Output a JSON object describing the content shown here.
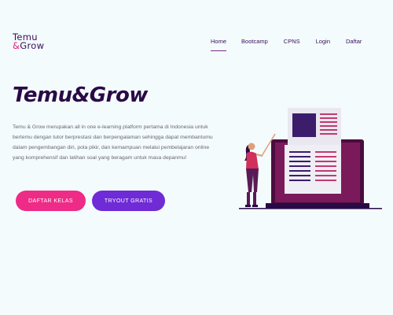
{
  "logo": {
    "line1": "Temu",
    "amp": "&",
    "line2_rest": "Grow"
  },
  "nav": {
    "items": [
      {
        "label": "Home",
        "active": true
      },
      {
        "label": "Bootcamp",
        "active": false
      },
      {
        "label": "CPNS",
        "active": false
      },
      {
        "label": "Login",
        "active": false
      },
      {
        "label": "Daftar",
        "active": false
      }
    ]
  },
  "hero": {
    "title": "Temu&Grow",
    "description": "Temu & Grow merupakan all in one e-learning platform pertama di Indonesia untuk bertemu dengan tutor berprestasi dan berpengalaman sehingga dapat membantumu dalam pengembangan diri, pola pikir, dan kemampuan melalui pembelajaran online yang komprehensif dan latihan soal yang beragam untuk masa depanmu!",
    "primary_button": "DAFTAR KELAS",
    "secondary_button": "TRYOUT GRATIS"
  },
  "colors": {
    "background": "#f3fbfd",
    "brand_dark": "#2a0a45",
    "accent_pink": "#ee2b87",
    "accent_purple": "#6f2bd6"
  },
  "illustration": {
    "icon": "presentation-illustration"
  }
}
